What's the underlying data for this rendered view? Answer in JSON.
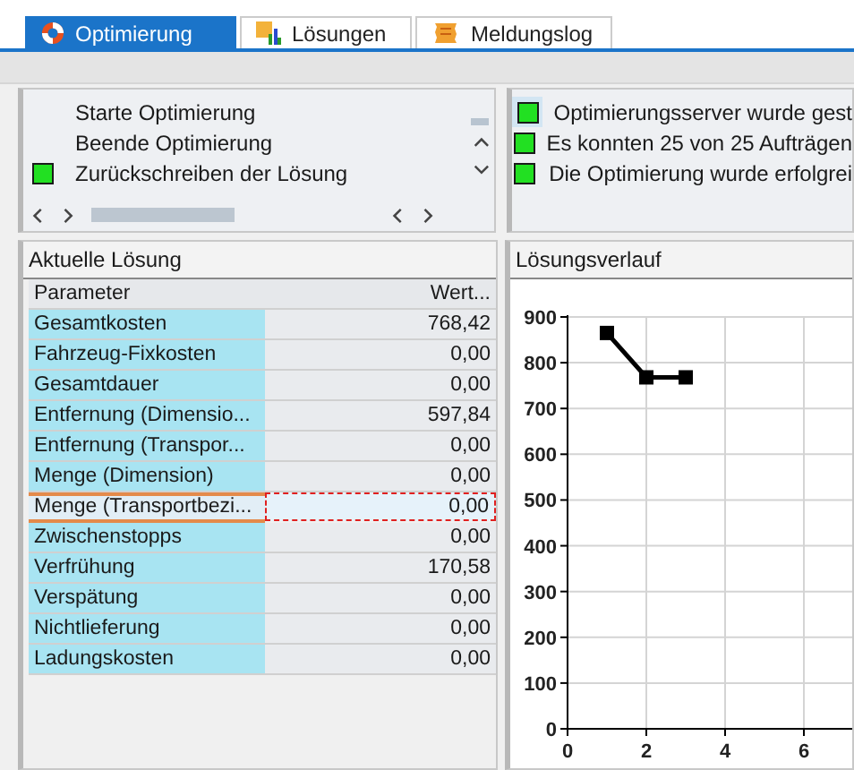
{
  "tabs": [
    {
      "label": "Optimierung",
      "selected": true
    },
    {
      "label": "Lösungen",
      "selected": false
    },
    {
      "label": "Meldungslog",
      "selected": false
    }
  ],
  "actions": [
    {
      "label": "Starte Optimierung",
      "marked": false
    },
    {
      "label": "Beende Optimierung",
      "marked": false
    },
    {
      "label": "Zurückschreiben der Lösung",
      "marked": true
    }
  ],
  "messages": [
    {
      "text": "Optimierungsserver  wurde gest",
      "selected": true
    },
    {
      "text": "Es konnten 25 von 25 Aufträgen",
      "selected": false
    },
    {
      "text": "Die Optimierung wurde erfolgrei",
      "selected": false
    }
  ],
  "solution": {
    "title": "Aktuelle Lösung",
    "columns": [
      "Parameter",
      "Wert..."
    ],
    "rows": [
      {
        "parameter": "Gesamtkosten",
        "value": "768,42",
        "selected": false
      },
      {
        "parameter": "Fahrzeug-Fixkosten",
        "value": "0,00",
        "selected": false
      },
      {
        "parameter": "Gesamtdauer",
        "value": "0,00",
        "selected": false
      },
      {
        "parameter": "Entfernung (Dimensio...",
        "value": "597,84",
        "selected": false
      },
      {
        "parameter": "Entfernung (Transpor...",
        "value": "0,00",
        "selected": false
      },
      {
        "parameter": "Menge (Dimension)",
        "value": "0,00",
        "selected": false
      },
      {
        "parameter": "Menge (Transportbezi...",
        "value": "0,00",
        "selected": true
      },
      {
        "parameter": "Zwischenstopps",
        "value": "0,00",
        "selected": false
      },
      {
        "parameter": "Verfrühung",
        "value": "170,58",
        "selected": false
      },
      {
        "parameter": "Verspätung",
        "value": "0,00",
        "selected": false
      },
      {
        "parameter": "Nichtlieferung",
        "value": "0,00",
        "selected": false
      },
      {
        "parameter": "Ladungskosten",
        "value": "0,00",
        "selected": false
      }
    ]
  },
  "history": {
    "title": "Lösungsverlauf",
    "chart_data": {
      "type": "line",
      "x": [
        1,
        2,
        3
      ],
      "series": [
        {
          "color": "#000000",
          "marker": "square",
          "values": [
            865,
            768,
            768
          ]
        }
      ],
      "grid": true,
      "xlim": [
        0,
        7.5
      ],
      "ylim": [
        0,
        900
      ],
      "xticks": [
        0,
        2,
        4,
        6
      ],
      "yticks": [
        0,
        100,
        200,
        300,
        400,
        500,
        600,
        700,
        800,
        900
      ]
    }
  }
}
